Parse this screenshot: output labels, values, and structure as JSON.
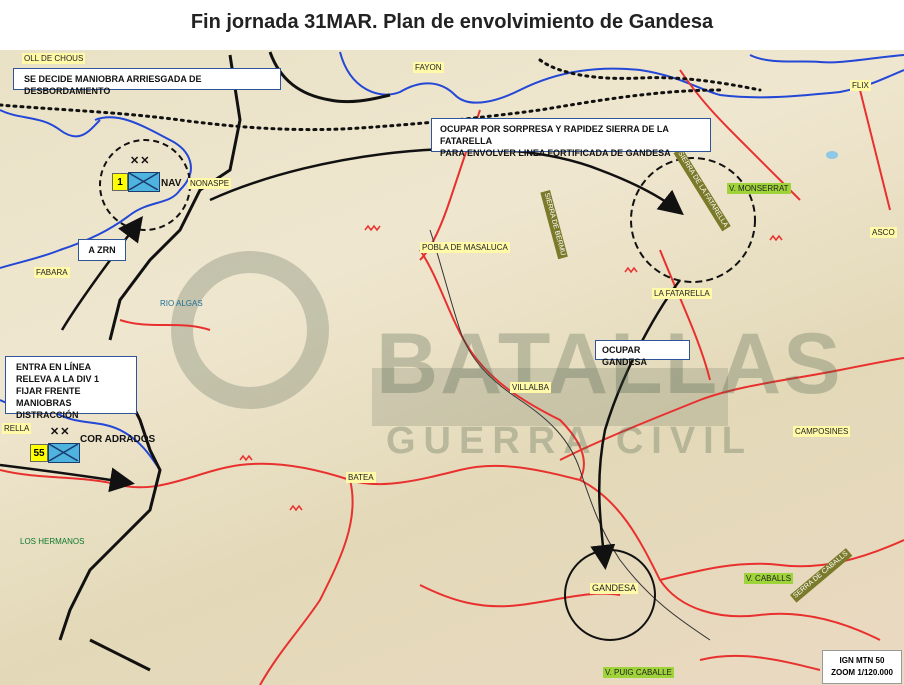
{
  "title": "Fin jornada 31MAR. Plan de envolvimiento de Gandesa",
  "boxes": {
    "maneuver": "SE DECIDE MANIOBRA ARRIESGADA DE DESBORDAMIENTO",
    "occupy_line1": "OCUPAR  POR SORPRESA Y RAPIDEZ SIERRA DE LA  FATARELLA",
    "occupy_line2": "PARA ENVOLVER  LINEA FORTIFICADA DE GANDESA",
    "zrn": "A ZRN",
    "entry_line1": "ENTRA EN LÍNEA",
    "entry_line2": "RELEVA A LA DIV 1",
    "entry_line3": "FIJAR FRENTE",
    "entry_line4": "MANIOBRAS DISTRACCIÓN",
    "occupy_gandesa": "OCUPAR  GANDESA"
  },
  "units": {
    "div1": {
      "number": "1",
      "name": "NAV",
      "echelon": "✕✕"
    },
    "div55": {
      "number": "55",
      "name": "COR ADRADOS",
      "echelon": "✕✕"
    }
  },
  "places": {
    "coll_de_chous": "OLL DE CHOUS",
    "fayon": "FAYON",
    "flix": "FLIX",
    "nonaspe": "NONASPE",
    "fabara": "FABARA",
    "pobla": "POBLA DE MASALUCA",
    "rio_algas": "RIO ALGAS",
    "la_fatarella": "LA FATARELLA",
    "monserrat": "V. MONSERRAT",
    "asco": "ASCO",
    "villalba": "VILLALBA",
    "camposines": "CAMPOSINES",
    "batea": "BATEA",
    "los_hermanos": "LOS HERMANOS",
    "corbera_partial": "RELLA",
    "gandesa": "GANDESA",
    "caballs": "V. CABALLS",
    "puig_caballe": "V. PUIG CABALLE",
    "sierra_fatarella": "SIERRA DE LA FATARELLA",
    "sierra_caballs": "SERRA DE CABALLS",
    "sierra_bermu": "SIERRA DE BERMU"
  },
  "watermark": {
    "line1": "BATALLAS",
    "line2": "GUERRA CIVIL"
  },
  "scale": {
    "line1": "IGN MTN 50",
    "line2": "ZOOM 1/120.000"
  },
  "colors": {
    "road": "#e8312f",
    "river": "#2347d6",
    "front": "#111111",
    "box_border": "#2f5597",
    "unit_fill": "#4fb3e0",
    "unit_number": "#ffff00"
  }
}
